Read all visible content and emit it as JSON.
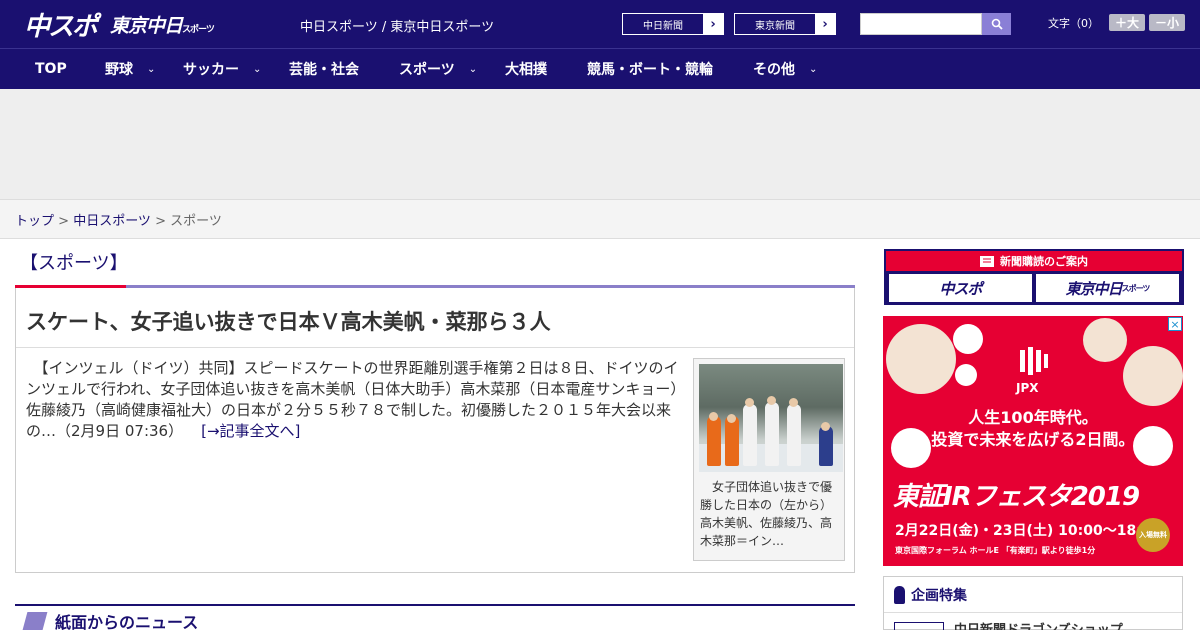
{
  "header": {
    "logo_main": "中スポ",
    "logo_sub": "東京中日",
    "logo_sub_small": "スポーツ",
    "site_links": "中日スポーツ / 東京中日スポーツ",
    "newspaper_links": [
      {
        "label": "中日新聞",
        "arrow": "›"
      },
      {
        "label": "東京新聞",
        "arrow": "›"
      }
    ],
    "search": {
      "value": "",
      "placeholder": ""
    },
    "font_size": {
      "label": "文字（0）",
      "bigger": "＋大",
      "smaller": "－小"
    }
  },
  "nav": {
    "items": [
      {
        "label": "TOP",
        "has_menu": false
      },
      {
        "label": "野球",
        "has_menu": true
      },
      {
        "label": "サッカー",
        "has_menu": true
      },
      {
        "label": "芸能・社会",
        "has_menu": false
      },
      {
        "label": "スポーツ",
        "has_menu": true
      },
      {
        "label": "大相撲",
        "has_menu": false
      },
      {
        "label": "競馬・ボート・競輪",
        "has_menu": false
      },
      {
        "label": "その他",
        "has_menu": true
      }
    ],
    "chevron": "⌄"
  },
  "breadcrumb": {
    "items": [
      "トップ",
      "中日スポーツ",
      "スポーツ"
    ],
    "separator": " > "
  },
  "main": {
    "category": "【スポーツ】",
    "article": {
      "title": "スケート、女子追い抜きで日本Ｖ高木美帆・菜那ら３人",
      "body": "　【インツェル（ドイツ）共同】スピードスケートの世界距離別選手権第２日は８日、ドイツのインツェルで行われ、女子団体追い抜きを高木美帆（日体大助手）高木菜那（日本電産サンキョー）佐藤綾乃（高崎健康福祉大）の日本が２分５５秒７８で制した。初優勝した２０１５年大会以来の…（2月9日 07:36）",
      "more_link": "[→記事全文へ]",
      "photo_caption": "女子団体追い抜きで優勝した日本の（左から）高木美帆、佐藤綾乃、高木菜那＝イン…"
    },
    "section_heading": "紙面からのニュース"
  },
  "sidebar": {
    "subscription": {
      "header": "新聞購読のご案内",
      "left": "中スポ",
      "right": "東京中日",
      "right_small": "スポーツ"
    },
    "ad": {
      "close": "×",
      "brand": "JPX",
      "line1": "人生100年時代。",
      "line2": "投資で未来を広げる2日間。",
      "fest": "東証IRフェスタ2019",
      "dates": "2月22日(金)・23日(土) 10:00～18:00",
      "venue": "東京国際フォーラム ホールE 「有楽町」駅より徒歩1分",
      "free": "入場無料"
    },
    "feature": {
      "heading": "企画特集",
      "item": "中日新聞ドラゴンズショップ"
    }
  },
  "colors": {
    "brand_navy": "#1a1070",
    "accent_red": "#e60033",
    "accent_purple": "#8a7fc9"
  }
}
